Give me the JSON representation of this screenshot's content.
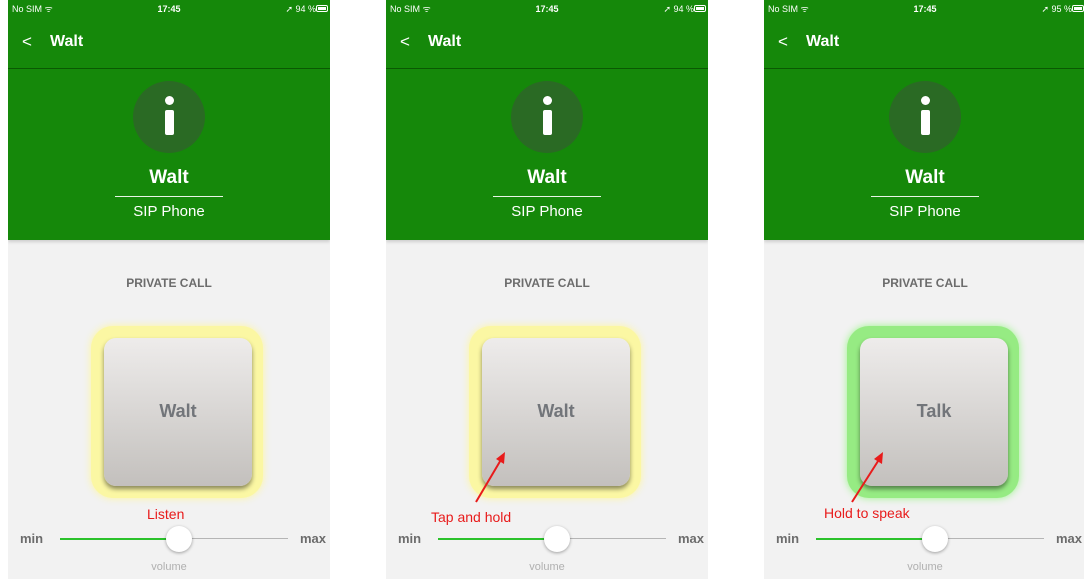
{
  "screens": [
    {
      "status": {
        "carrier": "No SIM ᯤ",
        "time": "17:45",
        "battery": "➚ 94 %"
      },
      "nav": {
        "back": "<",
        "title": "Walt"
      },
      "contact": {
        "name": "Walt",
        "subtitle": "SIP Phone"
      },
      "section": "PRIVATE CALL",
      "button_label": "Walt",
      "glow_color": "#fbf7a3",
      "annotation": "Listen",
      "volume": {
        "min": "min",
        "max": "max",
        "caption": "volume",
        "level": 0.5
      }
    },
    {
      "status": {
        "carrier": "No SIM ᯤ",
        "time": "17:45",
        "battery": "➚ 94 %"
      },
      "nav": {
        "back": "<",
        "title": "Walt"
      },
      "contact": {
        "name": "Walt",
        "subtitle": "SIP Phone"
      },
      "section": "PRIVATE CALL",
      "button_label": "Walt",
      "glow_color": "#fbf7a3",
      "annotation": "Tap and hold",
      "volume": {
        "min": "min",
        "max": "max",
        "caption": "volume",
        "level": 0.5
      }
    },
    {
      "status": {
        "carrier": "No SIM ᯤ",
        "time": "17:45",
        "battery": "➚ 95 %"
      },
      "nav": {
        "back": "<",
        "title": "Walt"
      },
      "contact": {
        "name": "Walt",
        "subtitle": "SIP Phone"
      },
      "section": "PRIVATE CALL",
      "button_label": "Talk",
      "glow_color": "#96eb83",
      "annotation": "Hold to speak",
      "volume": {
        "min": "min",
        "max": "max",
        "caption": "volume",
        "level": 0.5
      }
    }
  ],
  "colors": {
    "brand_green": "#15880a",
    "annotation_red": "#e81b1b",
    "slider_active": "#2bc22b"
  },
  "icons": {
    "back": "chevron-left-icon",
    "info": "info-icon",
    "battery": "battery-icon",
    "wifi": "wifi-icon"
  }
}
